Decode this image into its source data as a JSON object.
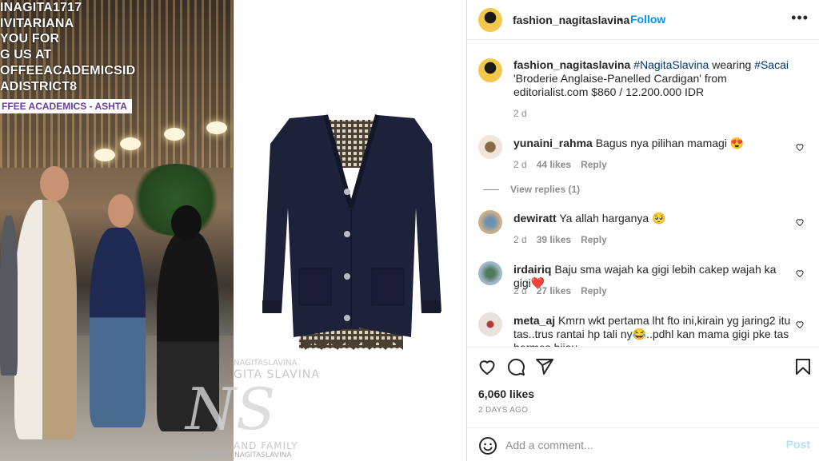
{
  "story": {
    "lines": [
      "INAGITA1717",
      "IVITARIANA",
      " YOU FOR",
      "G US AT",
      "OFFEEACADEMICSID",
      "ADISTRICT8"
    ],
    "location_tag": "FFEE ACADEMICS - ASHTA"
  },
  "watermark": {
    "handle_top": "NAGITASLAVINA",
    "name": "GITA SLAVINA",
    "logo_letters": "NS",
    "family": "AND FAMILY",
    "handle_bottom": "@FASHION_NAGITASLAVINA"
  },
  "header": {
    "username": "fashion_nagitaslavina",
    "separator": "•",
    "follow_label": "Follow",
    "more_icon": "more-horizontal-icon"
  },
  "caption": {
    "username": "fashion_nagitaslavina",
    "parts": [
      {
        "text": " ",
        "type": "text"
      },
      {
        "text": "#NagitaSlavina",
        "type": "hashtag"
      },
      {
        "text": " wearing ",
        "type": "text"
      },
      {
        "text": "#Sacai",
        "type": "hashtag"
      },
      {
        "text": " 'Broderie Anglaise-Panelled Cardigan' from editorialist.com $860 / 12.200.000 IDR",
        "type": "text"
      }
    ],
    "time": "2 d"
  },
  "comments": [
    {
      "username": "yunaini_rahma",
      "text": "Bagus nya pilihan mamagi 😍",
      "time": "2 d",
      "likes": "44 likes",
      "reply_label": "Reply",
      "view_replies": "View replies (1)"
    },
    {
      "username": "dewiratt",
      "text": "Ya allah harganya 🥺",
      "time": "2 d",
      "likes": "39 likes",
      "reply_label": "Reply"
    },
    {
      "username": "irdairiq",
      "text": "Baju sma wajah ka gigi lebih cakep wajah ka gigi❤️",
      "time": "2 d",
      "likes": "27 likes",
      "reply_label": "Reply"
    },
    {
      "username": "meta_aj",
      "text": "Kmrn wkt pertama lht fto ini,kirain yg jaring2 itu tas..trus rantai hp tali ny😂..pdhl kan mama gigi pke tas hermes bijou"
    }
  ],
  "actions": {
    "likes": "6,060 likes",
    "time_ago": "2 DAYS AGO",
    "icons": [
      "heart-icon",
      "comment-icon",
      "share-icon",
      "bookmark-icon"
    ]
  },
  "composer": {
    "placeholder": "Add a comment...",
    "post_label": "Post"
  },
  "colors": {
    "link_blue": "#0095f6",
    "hashtag": "#00376b",
    "muted": "#8e8e8e",
    "post_disabled": "#b2dffc"
  }
}
